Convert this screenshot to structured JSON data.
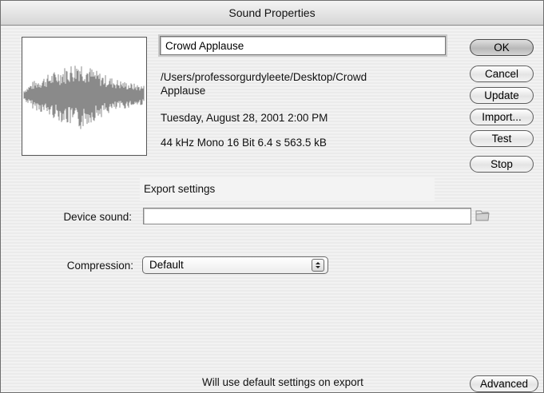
{
  "window": {
    "title": "Sound Properties"
  },
  "sound": {
    "name": "Crowd Applause",
    "path_line1": "/Users/professorgurdyleete/Desktop/Crowd",
    "path_line2": "Applause",
    "date": "Tuesday, August 28, 2001  2:00 PM",
    "format": "44 kHz Mono 16 Bit 6.4 s 563.5 kB"
  },
  "buttons": {
    "ok": "OK",
    "cancel": "Cancel",
    "update": "Update",
    "import": "Import...",
    "test": "Test",
    "stop": "Stop",
    "advanced": "Advanced"
  },
  "export": {
    "header": "Export settings",
    "device_sound_label": "Device sound:",
    "device_sound_value": "",
    "compression_label": "Compression:",
    "compression_value": "Default",
    "footer_note": "Will use default settings on export"
  },
  "icons": {
    "folder": "folder-icon",
    "select_arrows": "up-down-arrows-icon"
  }
}
